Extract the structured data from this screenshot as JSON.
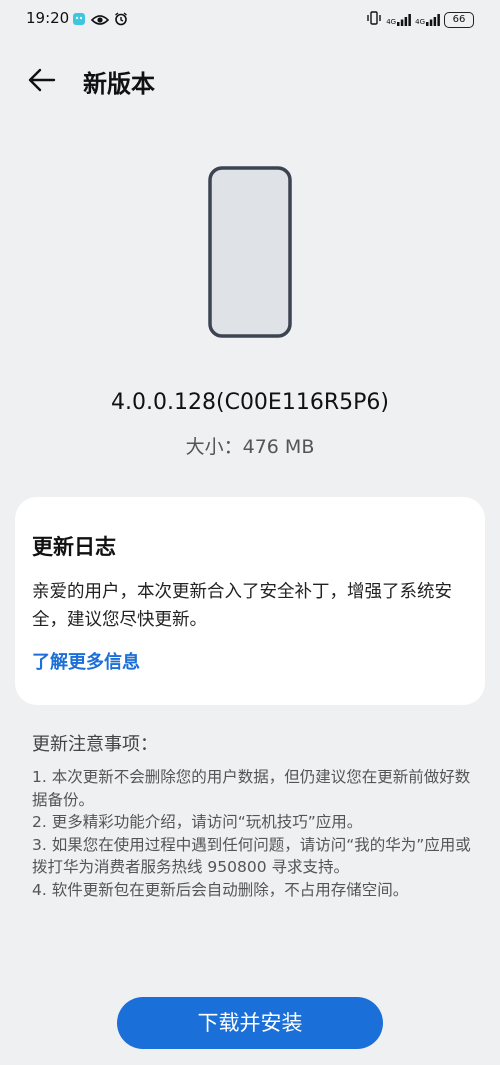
{
  "status_bar": {
    "time": "19:20",
    "signal_label_1": "4G",
    "signal_label_2": "4G",
    "battery": "66"
  },
  "header": {
    "title": "新版本"
  },
  "update": {
    "version": "4.0.0.128(C00E116R5P6)",
    "size": "大小：476 MB"
  },
  "changelog": {
    "title": "更新日志",
    "body": "亲爱的用户，本次更新合入了安全补丁，增强了系统安全，建议您尽快更新。",
    "link": "了解更多信息"
  },
  "notes": {
    "title": "更新注意事项：",
    "items": [
      "1. 本次更新不会删除您的用户数据，但仍建议您在更新前做好数据备份。",
      "2. 更多精彩功能介绍，请访问“玩机技巧”应用。",
      "3. 如果您在使用过程中遇到任何问题，请访问“我的华为”应用或拨打华为消费者服务热线 950800 寻求支持。",
      "4. 软件更新包在更新后会自动删除，不占用存储空间。"
    ]
  },
  "actions": {
    "install_label": "下载并安装"
  },
  "colors": {
    "accent": "#1a6fd8",
    "background": "#eef0f2",
    "card": "#ffffff"
  },
  "icons": {
    "back": "arrow-left-icon",
    "phone": "phone-illustration-icon"
  }
}
